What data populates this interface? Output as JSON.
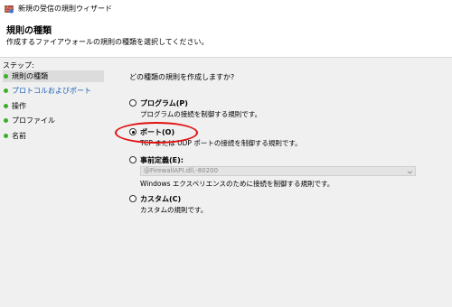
{
  "window": {
    "title": "新規の受信の規則ウィザード",
    "icon": "firewall-wizard-icon"
  },
  "header": {
    "title": "規則の種類",
    "subtitle": "作成するファイアウォールの規則の種類を選択してください。"
  },
  "steps": {
    "label": "ステップ:",
    "items": [
      {
        "label": "規則の種類",
        "state": "done"
      },
      {
        "label": "プロトコルおよびポート",
        "state": "active"
      },
      {
        "label": "操作",
        "state": "done"
      },
      {
        "label": "プロファイル",
        "state": "done"
      },
      {
        "label": "名前",
        "state": "done"
      }
    ],
    "dot_color": "#3dae2b",
    "active_color": "#1a5fb4"
  },
  "main": {
    "question": "どの種類の規則を作成しますか?",
    "options": [
      {
        "label": "プログラム(P)",
        "description": "プログラムの接続を制御する規則です。",
        "selected": false
      },
      {
        "label": "ポート(O)",
        "description": "TCP または UDP ポートの接続を制御する規則です。",
        "selected": true
      },
      {
        "label": "事前定義(E):",
        "select_value": "@FirewallAPI.dll,-80200",
        "description": "Windows エクスペリエンスのために接続を制御する規則です。",
        "selected": false
      },
      {
        "label": "カスタム(C)",
        "description": "カスタムの規則です。",
        "selected": false
      }
    ]
  },
  "annotation": {
    "type": "highlight-ellipse",
    "color": "#e01010"
  }
}
